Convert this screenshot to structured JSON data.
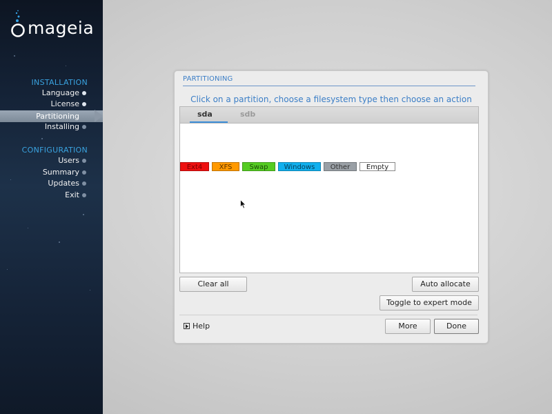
{
  "brand": {
    "name": "mageia"
  },
  "sidebar": {
    "sections": [
      {
        "title": "INSTALLATION",
        "items": [
          "Language",
          "License",
          "Partitioning",
          "Installing"
        ]
      },
      {
        "title": "CONFIGURATION",
        "items": [
          "Users",
          "Summary",
          "Updates",
          "Exit"
        ]
      }
    ],
    "active_item": "Partitioning"
  },
  "dialog": {
    "title": "PARTITIONING",
    "instruction": "Click on a partition, choose a filesystem type then choose an action",
    "tabs": [
      {
        "label": "sda",
        "selected": true
      },
      {
        "label": "sdb",
        "selected": false
      }
    ],
    "legend": [
      {
        "label": "Ext4",
        "color": "#ee1010"
      },
      {
        "label": "XFS",
        "color": "#ff9900"
      },
      {
        "label": "Swap",
        "color": "#55cc22"
      },
      {
        "label": "Windows",
        "color": "#11b0ee"
      },
      {
        "label": "Other",
        "color": "#9aa0a6"
      },
      {
        "label": "Empty",
        "color": "#ffffff"
      }
    ],
    "buttons": {
      "clear_all": "Clear all",
      "auto_allocate": "Auto allocate",
      "toggle_expert": "Toggle to expert mode",
      "help": "Help",
      "more": "More",
      "done": "Done"
    }
  },
  "colors": {
    "accent": "#3b7ec6",
    "section_title": "#3aa3e0"
  }
}
